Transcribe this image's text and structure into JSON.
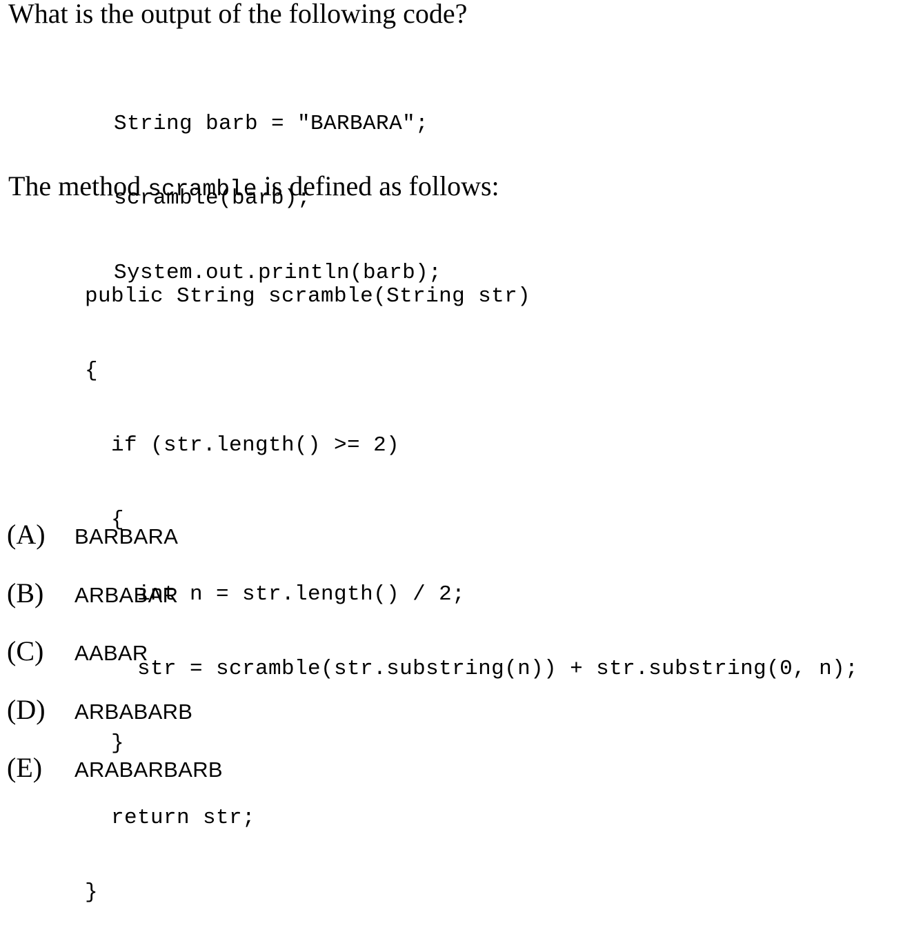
{
  "question": "What is the output of the following code?",
  "code_snippet": [
    "String barb = \"BARBARA\";",
    "scramble(barb);",
    "System.out.println(barb);"
  ],
  "method_intro": {
    "prefix": "The method ",
    "method_name": "scramble",
    "suffix": " is defined as follows:"
  },
  "method_code": [
    "public String scramble(String str)",
    "{",
    "  if (str.length() >= 2)",
    "  {",
    "    int n = str.length() / 2;",
    "    str = scramble(str.substring(n)) + str.substring(0, n);",
    "  }",
    "  return str;",
    "}"
  ],
  "choices": [
    {
      "letter": "(A)",
      "text": "BARBARA"
    },
    {
      "letter": "(B)",
      "text": "ARBABAR"
    },
    {
      "letter": "(C)",
      "text": "AABAR"
    },
    {
      "letter": "(D)",
      "text": "ARBABARB"
    },
    {
      "letter": "(E)",
      "text": "ARABARBARB"
    }
  ]
}
